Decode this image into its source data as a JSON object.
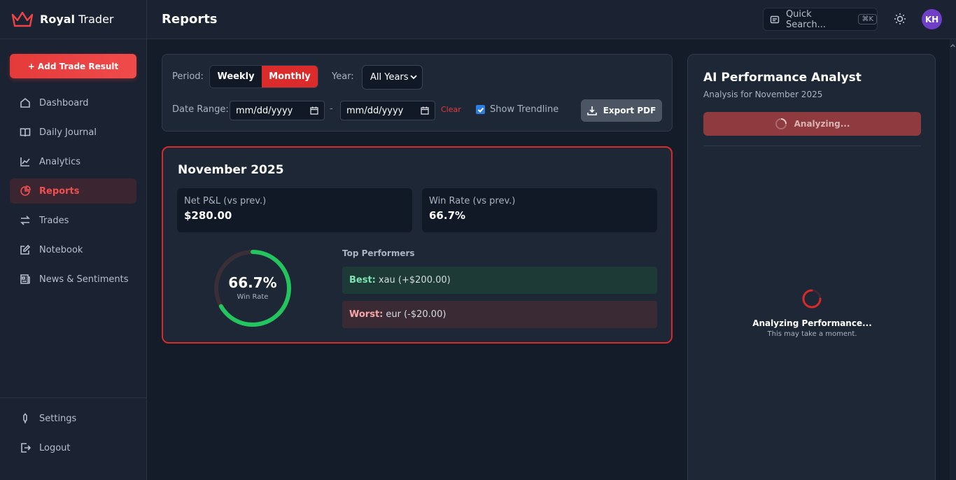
{
  "brand": {
    "name_bold": "Royal",
    "name_rest": " Trader"
  },
  "sidebar": {
    "add_button": "+ Add Trade Result",
    "items": [
      {
        "label": "Dashboard",
        "icon": "home-icon"
      },
      {
        "label": "Daily Journal",
        "icon": "book-icon"
      },
      {
        "label": "Analytics",
        "icon": "analytics-icon"
      },
      {
        "label": "Reports",
        "icon": "pie-chart-icon",
        "active": true
      },
      {
        "label": "Trades",
        "icon": "swap-icon"
      },
      {
        "label": "Notebook",
        "icon": "edit-icon"
      },
      {
        "label": "News & Sentiments",
        "icon": "newspaper-icon"
      }
    ],
    "bottom": [
      {
        "label": "Settings",
        "icon": "gear-icon"
      },
      {
        "label": "Logout",
        "icon": "logout-icon"
      }
    ]
  },
  "header": {
    "title": "Reports",
    "search_label": "Quick Search...",
    "search_shortcut": "⌘K",
    "avatar_initials": "KH"
  },
  "filters": {
    "period_label": "Period:",
    "period_options": [
      "Weekly",
      "Monthly"
    ],
    "period_selected": "Monthly",
    "year_label": "Year:",
    "year_value": "All Years",
    "date_range_label": "Date Range:",
    "date_from_placeholder": "mm/dd/yyyy",
    "date_to_placeholder": "mm/dd/yyyy",
    "date_separator": "-",
    "clear_label": "Clear",
    "trendline_label": "Show Trendline",
    "trendline_checked": true,
    "export_label": "Export PDF"
  },
  "report": {
    "title": "November 2025",
    "net_pnl_label": "Net P&L (vs prev.)",
    "net_pnl_value": "$280.00",
    "win_rate_label": "Win Rate (vs prev.)",
    "win_rate_value": "66.7%",
    "ring_value": "66.7%",
    "ring_fraction": 0.667,
    "ring_label": "Win Rate",
    "top_performers_label": "Top Performers",
    "best_label": "Best:",
    "best_value": "xau (+$200.00)",
    "worst_label": "Worst:",
    "worst_value": "eur (-$20.00)"
  },
  "ai": {
    "title": "AI Performance Analyst",
    "subtitle": "Analysis for November 2025",
    "button_label": "Analyzing...",
    "status": "Analyzing Performance...",
    "status_sub": "This may take a moment."
  },
  "colors": {
    "accent": "#dc2b2b",
    "success": "#22c55e",
    "background": "#141b29"
  }
}
